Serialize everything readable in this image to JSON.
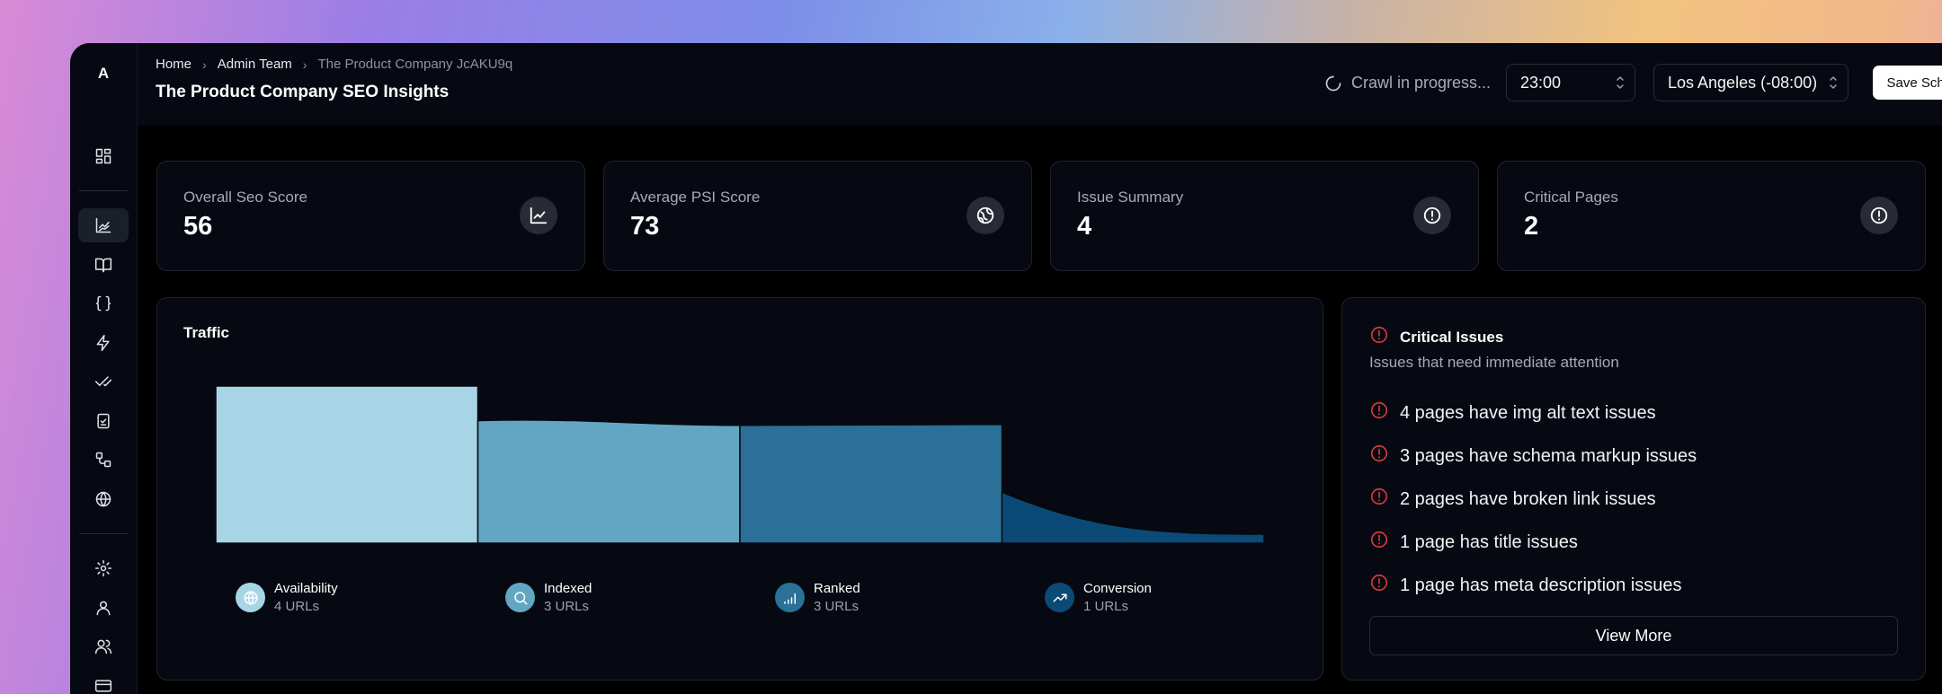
{
  "sidebar": {
    "logo": "A",
    "items": [
      {
        "icon": "dashboard-icon"
      },
      {
        "icon": "chart-line-icon",
        "active": true
      },
      {
        "icon": "book-open-icon"
      },
      {
        "icon": "braces-icon"
      },
      {
        "icon": "zap-icon"
      },
      {
        "icon": "check-check-icon"
      },
      {
        "icon": "clipboard-check-icon"
      },
      {
        "icon": "workflow-icon"
      },
      {
        "icon": "globe-icon"
      },
      {
        "icon": "gear-icon"
      },
      {
        "icon": "user-icon"
      },
      {
        "icon": "users-icon"
      },
      {
        "icon": "credit-card-icon"
      }
    ]
  },
  "header": {
    "breadcrumbs": [
      "Home",
      "Admin Team",
      "The Product Company JcAKU9q"
    ],
    "title": "The Product Company SEO Insights",
    "crawl_status": "Crawl in progress...",
    "time_value": "23:00",
    "timezone_value": "Los Angeles (-08:00)",
    "save_label": "Save Schedule"
  },
  "stats": [
    {
      "label": "Overall Seo Score",
      "value": "56",
      "icon": "chart-line-icon"
    },
    {
      "label": "Average PSI Score",
      "value": "73",
      "icon": "gauge-icon"
    },
    {
      "label": "Issue Summary",
      "value": "4",
      "icon": "alert-circle-icon"
    },
    {
      "label": "Critical Pages",
      "value": "2",
      "icon": "alert-circle-icon"
    }
  ],
  "traffic": {
    "title": "Traffic",
    "legend": [
      {
        "name": "Availability",
        "count": "4 URLs",
        "icon": "globe-icon",
        "color": "#a8d5e5"
      },
      {
        "name": "Indexed",
        "count": "3 URLs",
        "icon": "search-icon",
        "color": "#62a6c3"
      },
      {
        "name": "Ranked",
        "count": "3 URLs",
        "icon": "signal-icon",
        "color": "#2a7097"
      },
      {
        "name": "Conversion",
        "count": "1 URLs",
        "icon": "trending-up-icon",
        "color": "#0b4a76"
      }
    ]
  },
  "critical": {
    "title": "Critical Issues",
    "subtitle": "Issues that need immediate attention",
    "issues": [
      "4 pages have img alt text issues",
      "3 pages have schema markup issues",
      "2 pages have broken link issues",
      "1 page has title issues",
      "1 page has meta description issues"
    ],
    "view_more_label": "View More",
    "alert_color": "#d63a3a"
  },
  "chart_data": {
    "type": "area",
    "title": "Traffic",
    "categories": [
      "Availability",
      "Indexed",
      "Ranked",
      "Conversion"
    ],
    "values": [
      4,
      3,
      3,
      1
    ],
    "unit": "URLs",
    "colors": [
      "#a8d5e5",
      "#62a6c3",
      "#2a7097",
      "#0b4a76"
    ]
  }
}
